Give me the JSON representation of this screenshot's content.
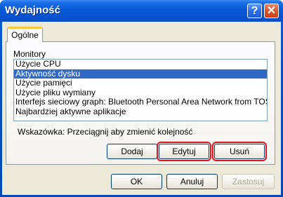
{
  "window": {
    "title": "Wydajność"
  },
  "titlebar": {
    "help_label": "?",
    "close_label": "✕"
  },
  "tabs": [
    {
      "label": "Ogólne"
    }
  ],
  "monitors": {
    "label": "Monitory",
    "items": [
      {
        "label": "Użycie CPU"
      },
      {
        "label": "Aktywność dysku"
      },
      {
        "label": "Użycie pamięci"
      },
      {
        "label": "Użycie pliku wymiany"
      },
      {
        "label": "Interfejs sieciowy graph: Bluetooth Personal Area Network from TOS..."
      },
      {
        "label": "Najbardziej aktywne aplikacje"
      }
    ],
    "selected_item": "Aktywność dysku"
  },
  "hint": "Wskazówka: Przeciągnij aby zmienić kolejność",
  "panel_buttons": {
    "add": "Dodaj",
    "edit": "Edytuj",
    "remove": "Usuń"
  },
  "dialog_buttons": {
    "ok": "OK",
    "cancel": "Anuluj",
    "apply": "Zastosuj"
  },
  "colors": {
    "titlebar": "#0a5bd8",
    "selection": "#316ac5",
    "highlight_outline": "#e0141e",
    "dialog_background": "#ece9d8"
  }
}
